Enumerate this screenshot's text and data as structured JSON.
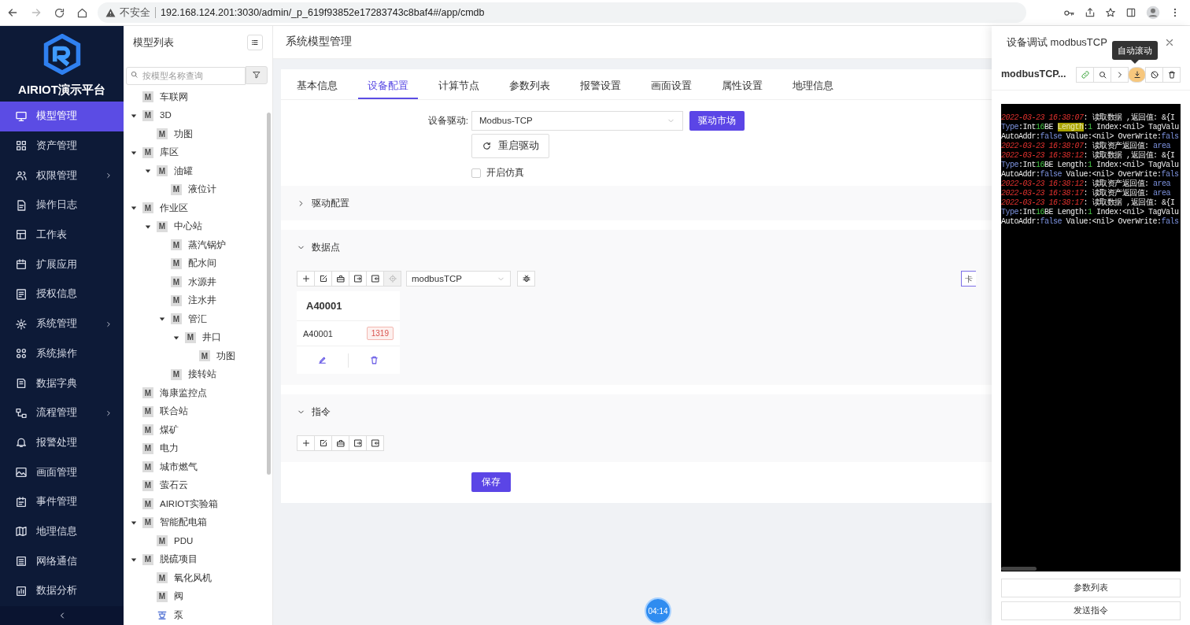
{
  "browser": {
    "security": "不安全",
    "url": "192.168.124.201:3030/admin/_p_619f93852e17283743c8baf4#/app/cmdb"
  },
  "sidebar": {
    "title": "AIRIOT演示平台",
    "items": [
      {
        "label": "模型管理",
        "selected": true,
        "submenu": false
      },
      {
        "label": "资产管理",
        "selected": false,
        "submenu": false
      },
      {
        "label": "权限管理",
        "selected": false,
        "submenu": true
      },
      {
        "label": "操作日志",
        "selected": false,
        "submenu": false
      },
      {
        "label": "工作表",
        "selected": false,
        "submenu": false
      },
      {
        "label": "扩展应用",
        "selected": false,
        "submenu": false
      },
      {
        "label": "授权信息",
        "selected": false,
        "submenu": false
      },
      {
        "label": "系统管理",
        "selected": false,
        "submenu": true
      },
      {
        "label": "系统操作",
        "selected": false,
        "submenu": false
      },
      {
        "label": "数据字典",
        "selected": false,
        "submenu": false
      },
      {
        "label": "流程管理",
        "selected": false,
        "submenu": true
      },
      {
        "label": "报警处理",
        "selected": false,
        "submenu": false
      },
      {
        "label": "画面管理",
        "selected": false,
        "submenu": false
      },
      {
        "label": "事件管理",
        "selected": false,
        "submenu": false
      },
      {
        "label": "地理信息",
        "selected": false,
        "submenu": false
      },
      {
        "label": "网络通信",
        "selected": false,
        "submenu": false
      },
      {
        "label": "数据分析",
        "selected": false,
        "submenu": false
      }
    ]
  },
  "model_tree": {
    "title": "模型列表",
    "search": {
      "placeholder": "按模型名称查询"
    },
    "nodes": [
      {
        "label": "车联网",
        "kind": "model",
        "badge": "M"
      },
      {
        "label": "3D",
        "kind": "model",
        "badge": "M",
        "expanded": true,
        "children": [
          {
            "label": "功图",
            "kind": "model",
            "badge": "M"
          }
        ]
      },
      {
        "label": "库区",
        "kind": "model",
        "badge": "M",
        "expanded": true,
        "children": [
          {
            "label": "油罐",
            "kind": "model",
            "badge": "M",
            "expanded": true,
            "children": [
              {
                "label": "液位计",
                "kind": "model",
                "badge": "M"
              }
            ]
          }
        ]
      },
      {
        "label": "作业区",
        "kind": "model",
        "badge": "M",
        "expanded": true,
        "children": [
          {
            "label": "中心站",
            "kind": "model",
            "badge": "M",
            "expanded": true,
            "children": [
              {
                "label": "蒸汽锅炉",
                "kind": "model",
                "badge": "M"
              },
              {
                "label": "配水间",
                "kind": "model",
                "badge": "M"
              },
              {
                "label": "水源井",
                "kind": "model",
                "badge": "M"
              },
              {
                "label": "注水井",
                "kind": "model",
                "badge": "M"
              },
              {
                "label": "管汇",
                "kind": "model",
                "badge": "M",
                "expanded": true,
                "children": [
                  {
                    "label": "井口",
                    "kind": "model",
                    "badge": "M",
                    "expanded": true,
                    "children": [
                      {
                        "label": "功图",
                        "kind": "model",
                        "badge": "M"
                      }
                    ]
                  }
                ]
              },
              {
                "label": "接转站",
                "kind": "model",
                "badge": "M"
              }
            ]
          }
        ]
      },
      {
        "label": "海康监控点",
        "kind": "model",
        "badge": "M"
      },
      {
        "label": "联合站",
        "kind": "model",
        "badge": "M"
      },
      {
        "label": "煤矿",
        "kind": "model",
        "badge": "M"
      },
      {
        "label": "电力",
        "kind": "model",
        "badge": "M"
      },
      {
        "label": "城市燃气",
        "kind": "model",
        "badge": "M"
      },
      {
        "label": "萤石云",
        "kind": "model",
        "badge": "M"
      },
      {
        "label": "AIRIOT实验箱",
        "kind": "model",
        "badge": "M"
      },
      {
        "label": "智能配电箱",
        "kind": "model",
        "badge": "M",
        "expanded": true,
        "children": [
          {
            "label": "PDU",
            "kind": "model",
            "badge": "M"
          }
        ]
      },
      {
        "label": "脱硫项目",
        "kind": "model",
        "badge": "M",
        "expanded": true,
        "children": [
          {
            "label": "氧化风机",
            "kind": "model",
            "badge": "M"
          },
          {
            "label": "阀",
            "kind": "model",
            "badge": "M"
          },
          {
            "label": "泵",
            "kind": "pump"
          }
        ]
      }
    ]
  },
  "page_title": "系统模型管理",
  "tabs": [
    {
      "label": "基本信息",
      "selected": false
    },
    {
      "label": "设备配置",
      "selected": true
    },
    {
      "label": "计算节点",
      "selected": false
    },
    {
      "label": "参数列表",
      "selected": false
    },
    {
      "label": "报警设置",
      "selected": false
    },
    {
      "label": "画面设置",
      "selected": false
    },
    {
      "label": "属性设置",
      "selected": false
    },
    {
      "label": "地理信息",
      "selected": false
    }
  ],
  "device_config": {
    "driver_label": "设备驱动:",
    "driver_value": "Modbus-TCP",
    "market_button": "驱动市场",
    "restart_button": "重启驱动",
    "simulation": {
      "label": "开启仿真",
      "checked": false
    }
  },
  "sections": [
    {
      "title": "驱动配置",
      "expanded": false
    },
    {
      "title": "数据点",
      "expanded": true,
      "tools": [
        {
          "disabled": false
        },
        {
          "disabled": false
        },
        {
          "disabled": false
        },
        {
          "disabled": false
        },
        {
          "disabled": false
        },
        {
          "disabled": true
        }
      ],
      "instance_select": "modbusTCP",
      "view_button": "卡",
      "cards": [
        {
          "title": "A40001",
          "name": "A40001",
          "value": "1319"
        }
      ]
    },
    {
      "title": "指令",
      "expanded": true,
      "tools": [
        {
          "disabled": false
        },
        {
          "disabled": false
        },
        {
          "disabled": false
        },
        {
          "disabled": false
        },
        {
          "disabled": false
        }
      ]
    }
  ],
  "save_button": "保存",
  "recording_timer": "04:14",
  "debug_drawer": {
    "title": "设备调试 modbusTCP",
    "tooltip": "自动滚动",
    "instance": "modbusTCP...",
    "tools": [
      {
        "hovered": false
      },
      {
        "hovered": false
      },
      {
        "hovered": false
      },
      {
        "hovered": true
      },
      {
        "hovered": false
      },
      {
        "hovered": false
      }
    ],
    "log": [
      [
        {
          "kind": "time",
          "text": "2022-03-23 16:38:07"
        },
        {
          "kind": "text",
          "text": ": 读取数据 ,返回值: &{I"
        }
      ],
      [
        {
          "kind": "kw",
          "text": "Type"
        },
        {
          "kind": "text",
          "text": ":Int"
        },
        {
          "kind": "num",
          "text": "16"
        },
        {
          "kind": "text",
          "text": "BE "
        },
        {
          "kind": "mark",
          "text": "Length"
        },
        {
          "kind": "text",
          "text": ":"
        },
        {
          "kind": "num",
          "text": "1"
        },
        {
          "kind": "text",
          "text": " Index:<nil> TagValu"
        }
      ],
      [
        {
          "kind": "text",
          "text": "AutoAddr:"
        },
        {
          "kind": "kw",
          "text": "false"
        },
        {
          "kind": "text",
          "text": " Value:<nil> OverWrite:"
        },
        {
          "kind": "kw",
          "text": "fals"
        }
      ],
      [
        {
          "kind": "time",
          "text": "2022-03-23 16:38:07"
        },
        {
          "kind": "text",
          "text": ": 读取资产返回值: "
        },
        {
          "kind": "kw",
          "text": "area"
        }
      ],
      [
        {
          "kind": "time",
          "text": "2022-03-23 16:38:12"
        },
        {
          "kind": "text",
          "text": ": 读取数据 ,返回值: &{I"
        }
      ],
      [
        {
          "kind": "kw",
          "text": "Type"
        },
        {
          "kind": "text",
          "text": ":Int"
        },
        {
          "kind": "num",
          "text": "16"
        },
        {
          "kind": "text",
          "text": "BE Length:"
        },
        {
          "kind": "num",
          "text": "1"
        },
        {
          "kind": "text",
          "text": " Index:<nil> TagValu"
        }
      ],
      [
        {
          "kind": "text",
          "text": "AutoAddr:"
        },
        {
          "kind": "kw",
          "text": "false"
        },
        {
          "kind": "text",
          "text": " Value:<nil> OverWrite:"
        },
        {
          "kind": "kw",
          "text": "fals"
        }
      ],
      [
        {
          "kind": "time",
          "text": "2022-03-23 16:38:12"
        },
        {
          "kind": "text",
          "text": ": 读取资产返回值: "
        },
        {
          "kind": "kw",
          "text": "area"
        }
      ],
      [
        {
          "kind": "time",
          "text": "2022-03-23 16:38:17"
        },
        {
          "kind": "text",
          "text": ": 读取资产返回值: "
        },
        {
          "kind": "kw",
          "text": "area"
        }
      ],
      [
        {
          "kind": "time",
          "text": "2022-03-23 16:38:17"
        },
        {
          "kind": "text",
          "text": ": 读取数据 ,返回值: &{I"
        }
      ],
      [
        {
          "kind": "kw",
          "text": "Type"
        },
        {
          "kind": "text",
          "text": ":Int"
        },
        {
          "kind": "num",
          "text": "16"
        },
        {
          "kind": "text",
          "text": "BE Length:"
        },
        {
          "kind": "num",
          "text": "1"
        },
        {
          "kind": "text",
          "text": " Index:<nil> TagValu"
        }
      ],
      [
        {
          "kind": "text",
          "text": "AutoAddr:"
        },
        {
          "kind": "kw",
          "text": "false"
        },
        {
          "kind": "text",
          "text": " Value:<nil> OverWrite:"
        },
        {
          "kind": "kw",
          "text": "fals"
        }
      ]
    ],
    "bottom_buttons": [
      "参数列表",
      "发送指令"
    ]
  }
}
